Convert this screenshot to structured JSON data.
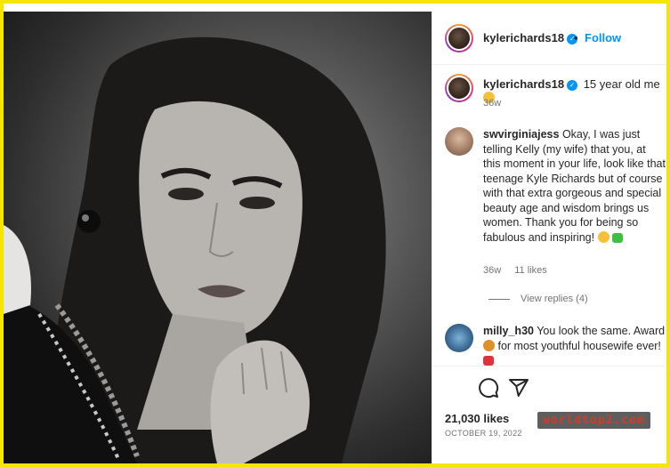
{
  "post": {
    "username": "kylerichards18",
    "follow_label": "Follow",
    "separator": "•",
    "caption_text": "15 year old me",
    "caption_age": "36w",
    "likes": "21,030 likes",
    "date": "OCTOBER 19, 2022"
  },
  "comments": [
    {
      "username": "swvirginiajess",
      "text": "Okay, I was just telling Kelly (my wife) that you, at this moment in your life, look like that teenage Kyle Richards but of course with that extra gorgeous and special beauty age and wisdom brings us women. Thank you for being so fabulous and inspiring!",
      "age": "36w",
      "likes": "11 likes",
      "view_replies": "View replies (4)"
    },
    {
      "username": "milly_h30",
      "text_part1": "You look the same. Award",
      "text_part2": "for most youthful housewife ever!"
    }
  ],
  "icons": {
    "verified": "verified-badge-icon",
    "comment": "comment-icon",
    "share": "share-icon"
  },
  "colors": {
    "accent": "#0095f6",
    "frame": "#f5e600"
  },
  "watermark": "worldtop2.com"
}
